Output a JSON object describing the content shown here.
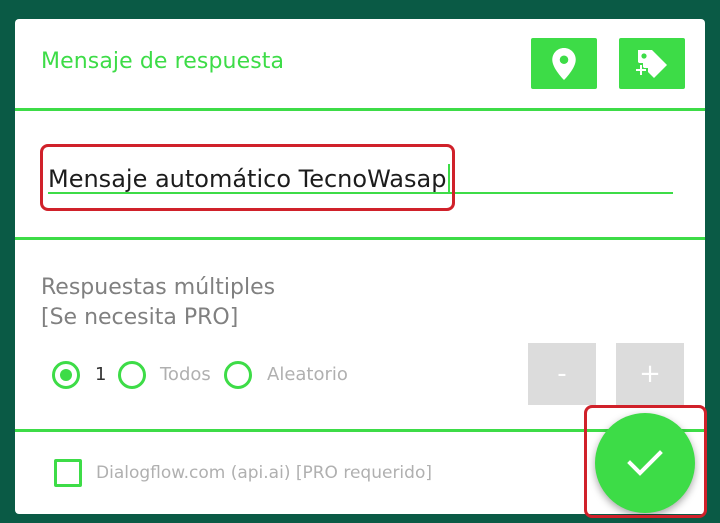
{
  "header": {
    "title": "Mensaje de respuesta",
    "location_icon": "location-pin-icon",
    "tag_icon": "tag-plus-icon"
  },
  "message_input": {
    "value": "Mensaje automático TecnoWasap"
  },
  "multiple_responses": {
    "title": "Respuestas múltiples",
    "subtitle": "[Se necesita PRO]",
    "options": [
      {
        "label": "1",
        "selected": true
      },
      {
        "label": "Todos",
        "selected": false
      },
      {
        "label": "Aleatorio",
        "selected": false
      }
    ],
    "minus_label": "-",
    "plus_label": "+"
  },
  "dialogflow": {
    "label": "Dialogflow.com (api.ai) [PRO requerido]",
    "checked": false
  },
  "fab": {
    "icon": "check-icon"
  },
  "colors": {
    "accent": "#3ddc47",
    "background": "#0a5a45",
    "highlight": "#d0212a",
    "disabled": "#dcdcdc"
  }
}
